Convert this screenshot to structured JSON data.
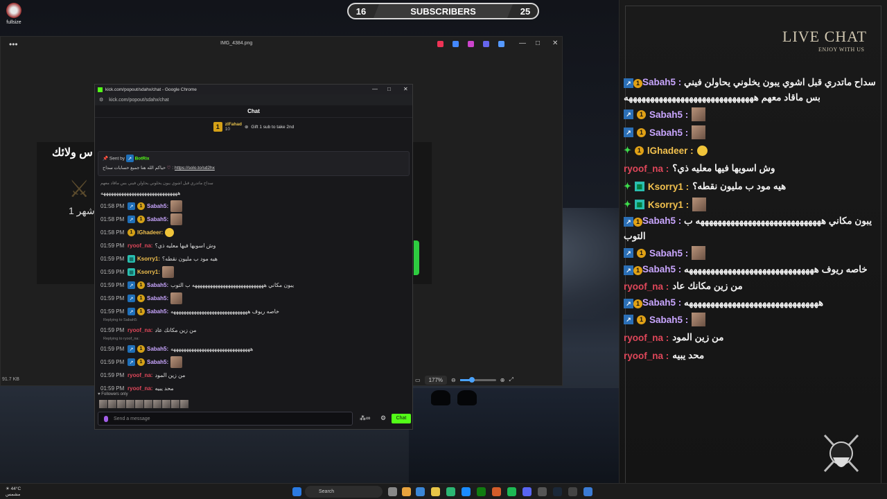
{
  "desktop": {
    "icon_label": "fullsize"
  },
  "subscribers": {
    "current": "16",
    "label": "SUBSCRIBERS",
    "goal": "25"
  },
  "viewer": {
    "filename": "IMG_4384.png",
    "image_text": "س ولائك",
    "image_subtext": "شهر 1",
    "file_size": "91.7 KB",
    "zoom": "177%"
  },
  "chrome": {
    "title": "kick.com/popout/sdahx/chat - Google Chrome",
    "url": "kick.com/popout/sdahx/chat",
    "header": "Chat",
    "gift": {
      "name": "zlFahad",
      "count": "10",
      "text": "Gift 1 sub to take 2nd"
    },
    "pinned": {
      "sent_by": "Sent by",
      "bot": "BotRix",
      "message": "حياكم الله هنا جميع حسابات سداح",
      "link": "https://solo.to/sd2hx"
    },
    "partial_line": "سداح ماتدري قبل اشوي يبون يخلوني يحاولن فيني بس ماقاد معهم",
    "first_line": "ههههههههههههههههههههههههههههههه",
    "messages": [
      {
        "time": "01:58 PM",
        "user": "Sabah5:",
        "text": "",
        "avatar": true,
        "badges": "kick"
      },
      {
        "time": "01:58 PM",
        "user": "Sabah5:",
        "text": "",
        "avatar": true,
        "badges": "kick"
      },
      {
        "time": "01:58 PM",
        "user": "lGhadeer:",
        "text": "",
        "emote": true,
        "badges": "sub"
      },
      {
        "time": "01:59 PM",
        "user": "ryoof_na:",
        "text": "وش اسويها فيها معليه ذي؟",
        "badges": ""
      },
      {
        "time": "01:59 PM",
        "user": "Ksorry1:",
        "text": "هيه مود ب مليون نقطه؟",
        "badges": "kc"
      },
      {
        "time": "01:59 PM",
        "user": "Ksorry1:",
        "text": "",
        "avatar": true,
        "badges": "kc"
      },
      {
        "time": "01:59 PM",
        "user": "Sabah5:",
        "text": "يبون مكاني ههههههههههههههههههههههههههههه ب التوب",
        "badges": "kick"
      },
      {
        "time": "01:59 PM",
        "user": "Sabah5:",
        "text": "",
        "avatar": true,
        "badges": "kick"
      },
      {
        "time": "01:59 PM",
        "user": "Sabah5:",
        "text": "خاصه ريوف ههههههههههههههههههههههههههههههه",
        "badges": "kick"
      },
      {
        "time": "01:59 PM",
        "user": "ryoof_na:",
        "text": "من زين مكانك عاد",
        "badges": "",
        "reply": "Replying to Sabah5:"
      },
      {
        "time": "01:59 PM",
        "user": "Sabah5:",
        "text": "هههههههههههههههههههههههههههههههه",
        "badges": "kick",
        "reply": "Replying to ryoof_na:"
      },
      {
        "time": "01:59 PM",
        "user": "Sabah5:",
        "text": "",
        "avatar": true,
        "badges": "kick"
      },
      {
        "time": "01:59 PM",
        "user": "ryoof_na:",
        "text": "من زين المود",
        "badges": ""
      },
      {
        "time": "01:59 PM",
        "user": "ryoof_na:",
        "text": "محد يبيه",
        "badges": ""
      }
    ],
    "followers_only": "Followers only",
    "input_placeholder": "Send a message",
    "chat_button": "Chat"
  },
  "livechat": {
    "title": "LIVE CHAT",
    "subtitle": "ENJOY WITH US",
    "lines": [
      {
        "user": "Sabah5 :",
        "text": "سداح ماتدري قبل اشوي يبون يخلوني يحاولن فيني بس ماقاد معهم ههههههههههههههههههههههههههههههه",
        "wrap": true
      },
      {
        "user": "Sabah5 :",
        "text": "",
        "avatar": true
      },
      {
        "user": "Sabah5 :",
        "text": "",
        "avatar": true
      },
      {
        "user": "lGhadeer :",
        "text": "",
        "emote": true,
        "diamond": true
      },
      {
        "user": "ryoof_na :",
        "text": "وش اسويها فيها معليه ذي؟",
        "plain": true
      },
      {
        "user": "Ksorry1 :",
        "text": "هيه مود ب مليون نقطه؟",
        "diamond": true
      },
      {
        "user": "Ksorry1 :",
        "text": "",
        "avatar": true,
        "diamond": true
      },
      {
        "user": "Sabah5 :",
        "text": "يبون مكاني هههههههههههههههههههههههههههههه ب التوب",
        "wrap": true
      },
      {
        "user": "Sabah5 :",
        "text": "",
        "avatar": true
      },
      {
        "user": "Sabah5 :",
        "text": "خاصه ريوف ههههههههههههههههههههههههههههههه",
        "wrap": true
      },
      {
        "user": "ryoof_na :",
        "text": "من زين مكانك عاد",
        "plain": true
      },
      {
        "user": "Sabah5 :",
        "text": "هههههههههههههههههههههههههههههههه",
        "wrap": true
      },
      {
        "user": "Sabah5 :",
        "text": "",
        "avatar": true
      },
      {
        "user": "ryoof_na :",
        "text": "من زين المود",
        "plain": true
      },
      {
        "user": "ryoof_na :",
        "text": "محد يبيه",
        "plain": true
      }
    ]
  },
  "taskbar": {
    "weather_temp": "44°C",
    "weather_desc": "مشمس",
    "search": "Search"
  },
  "colors": {
    "kick_green": "#53fc18",
    "sabah": "#c9a6ff",
    "ryoof": "#e0475a",
    "ghadeer": "#f2c14e",
    "ksorry": "#f2c14e"
  }
}
